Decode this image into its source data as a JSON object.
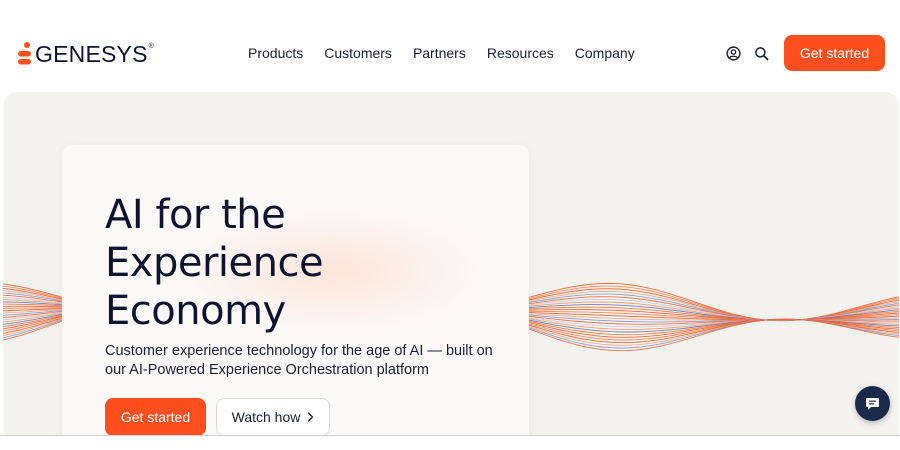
{
  "brand": {
    "name": "GENESYS",
    "trademark": "®",
    "accent_color": "#ff4f1f",
    "navy_color": "#1c2a4a"
  },
  "nav": {
    "items": [
      {
        "label": "Products"
      },
      {
        "label": "Customers"
      },
      {
        "label": "Partners"
      },
      {
        "label": "Resources"
      },
      {
        "label": "Company"
      }
    ]
  },
  "header": {
    "icons": [
      "user-icon",
      "search-icon"
    ],
    "cta_label": "Get started"
  },
  "hero": {
    "title_lines": [
      "AI for the",
      "Experience",
      "Economy"
    ],
    "subtitle": "Customer experience technology for the age of AI — built on our AI-Powered Experience Orchestration platform",
    "primary_cta": "Get started",
    "secondary_cta": "Watch how"
  },
  "chat": {
    "icon": "chat-icon"
  }
}
